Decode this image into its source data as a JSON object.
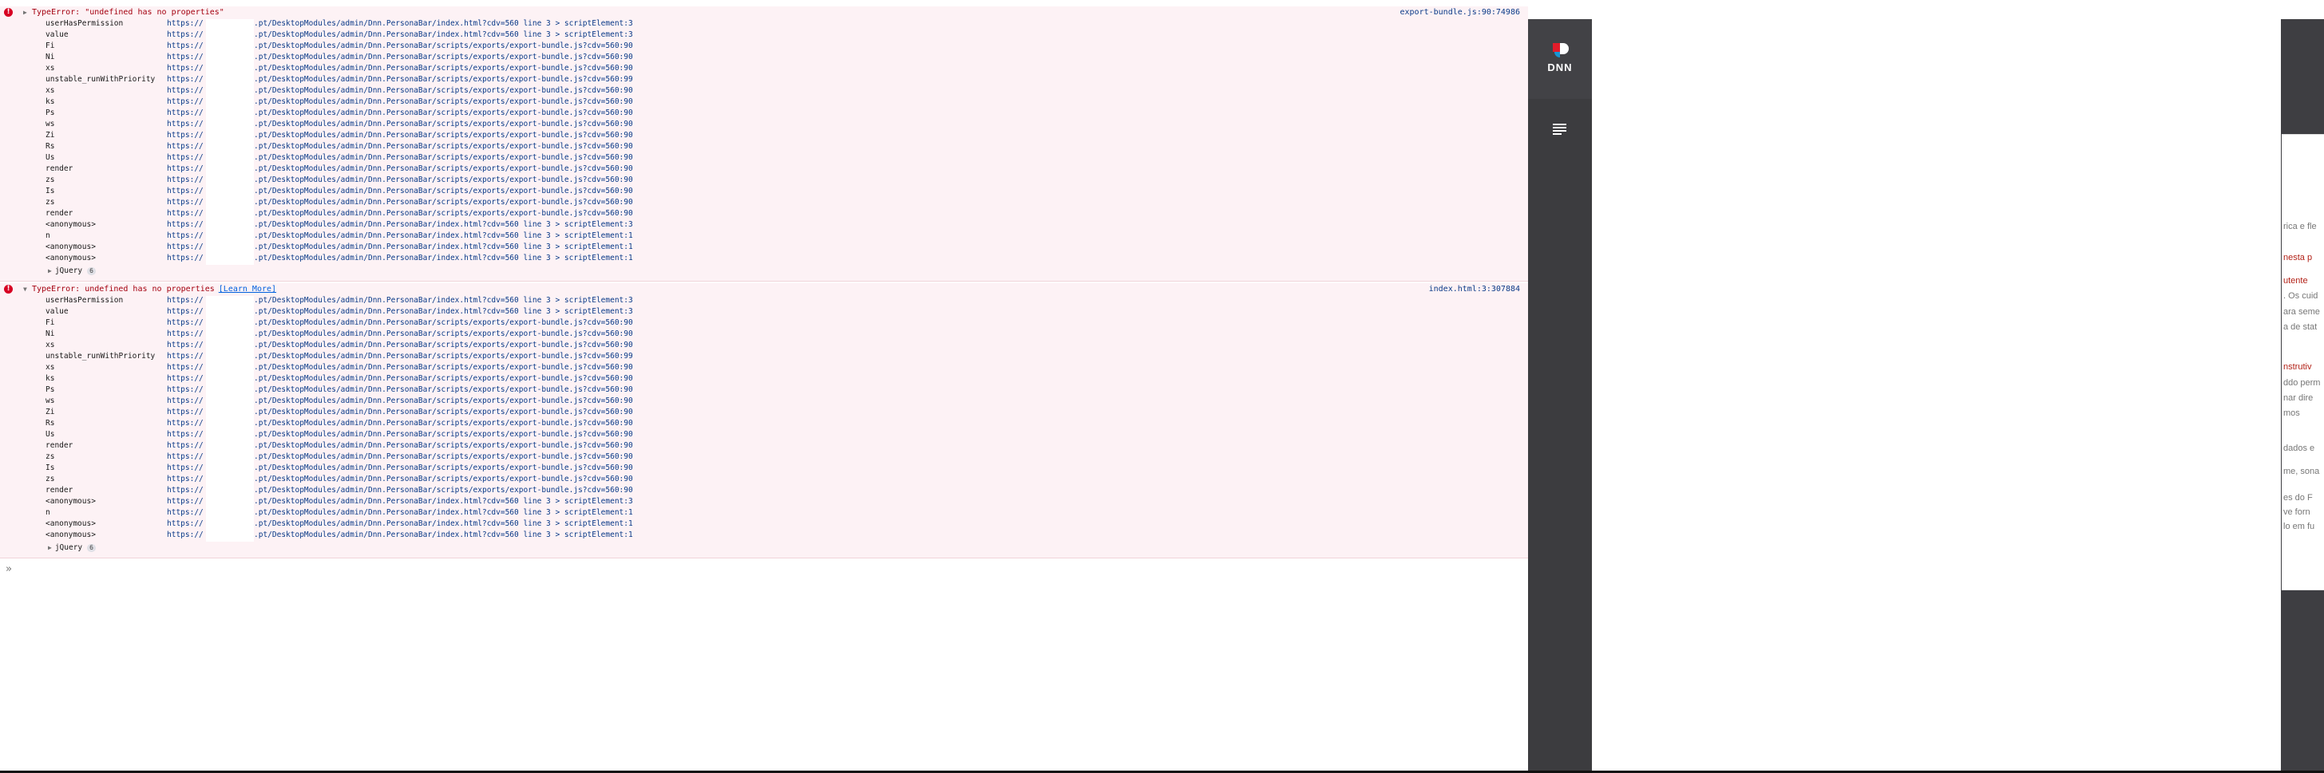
{
  "console": {
    "errors": [
      {
        "message": "TypeError: \"undefined has no properties\"",
        "learn_more": "",
        "source": "export-bundle.js:90:74986",
        "jquery_label": "jQuery",
        "jquery_count": "6"
      },
      {
        "message": "TypeError: undefined has no properties",
        "learn_more": "[Learn More]",
        "source": "index.html:3:307884",
        "jquery_label": "jQuery",
        "jquery_count": "6"
      }
    ],
    "frames": [
      {
        "fn": "userHasPermission",
        "url_prefix": "https://",
        "url_suffix": ".pt/DesktopModules/admin/Dnn.PersonaBar/index.html?cdv=560 line 3 > scriptElement:3"
      },
      {
        "fn": "value",
        "url_prefix": "https://",
        "url_suffix": ".pt/DesktopModules/admin/Dnn.PersonaBar/index.html?cdv=560 line 3 > scriptElement:3"
      },
      {
        "fn": "Fi",
        "url_prefix": "https://",
        "url_suffix": ".pt/DesktopModules/admin/Dnn.PersonaBar/scripts/exports/export-bundle.js?cdv=560:90"
      },
      {
        "fn": "Ni",
        "url_prefix": "https://",
        "url_suffix": ".pt/DesktopModules/admin/Dnn.PersonaBar/scripts/exports/export-bundle.js?cdv=560:90"
      },
      {
        "fn": "xs",
        "url_prefix": "https://",
        "url_suffix": ".pt/DesktopModules/admin/Dnn.PersonaBar/scripts/exports/export-bundle.js?cdv=560:90"
      },
      {
        "fn": "unstable_runWithPriority",
        "url_prefix": "https://",
        "url_suffix": ".pt/DesktopModules/admin/Dnn.PersonaBar/scripts/exports/export-bundle.js?cdv=560:99"
      },
      {
        "fn": "xs",
        "url_prefix": "https://",
        "url_suffix": ".pt/DesktopModules/admin/Dnn.PersonaBar/scripts/exports/export-bundle.js?cdv=560:90"
      },
      {
        "fn": "ks",
        "url_prefix": "https://",
        "url_suffix": ".pt/DesktopModules/admin/Dnn.PersonaBar/scripts/exports/export-bundle.js?cdv=560:90"
      },
      {
        "fn": "Ps",
        "url_prefix": "https://",
        "url_suffix": ".pt/DesktopModules/admin/Dnn.PersonaBar/scripts/exports/export-bundle.js?cdv=560:90"
      },
      {
        "fn": "ws",
        "url_prefix": "https://",
        "url_suffix": ".pt/DesktopModules/admin/Dnn.PersonaBar/scripts/exports/export-bundle.js?cdv=560:90"
      },
      {
        "fn": "Zi",
        "url_prefix": "https://",
        "url_suffix": ".pt/DesktopModules/admin/Dnn.PersonaBar/scripts/exports/export-bundle.js?cdv=560:90"
      },
      {
        "fn": "Rs",
        "url_prefix": "https://",
        "url_suffix": ".pt/DesktopModules/admin/Dnn.PersonaBar/scripts/exports/export-bundle.js?cdv=560:90"
      },
      {
        "fn": "Us",
        "url_prefix": "https://",
        "url_suffix": ".pt/DesktopModules/admin/Dnn.PersonaBar/scripts/exports/export-bundle.js?cdv=560:90"
      },
      {
        "fn": "render",
        "url_prefix": "https://",
        "url_suffix": ".pt/DesktopModules/admin/Dnn.PersonaBar/scripts/exports/export-bundle.js?cdv=560:90"
      },
      {
        "fn": "zs",
        "url_prefix": "https://",
        "url_suffix": ".pt/DesktopModules/admin/Dnn.PersonaBar/scripts/exports/export-bundle.js?cdv=560:90"
      },
      {
        "fn": "Is",
        "url_prefix": "https://",
        "url_suffix": ".pt/DesktopModules/admin/Dnn.PersonaBar/scripts/exports/export-bundle.js?cdv=560:90"
      },
      {
        "fn": "zs",
        "url_prefix": "https://",
        "url_suffix": ".pt/DesktopModules/admin/Dnn.PersonaBar/scripts/exports/export-bundle.js?cdv=560:90"
      },
      {
        "fn": "render",
        "url_prefix": "https://",
        "url_suffix": ".pt/DesktopModules/admin/Dnn.PersonaBar/scripts/exports/export-bundle.js?cdv=560:90"
      },
      {
        "fn": "<anonymous>",
        "url_prefix": "https://",
        "url_suffix": ".pt/DesktopModules/admin/Dnn.PersonaBar/index.html?cdv=560 line 3 > scriptElement:3"
      },
      {
        "fn": "n",
        "url_prefix": "https://",
        "url_suffix": ".pt/DesktopModules/admin/Dnn.PersonaBar/index.html?cdv=560 line 3 > scriptElement:1"
      },
      {
        "fn": "<anonymous>",
        "url_prefix": "https://",
        "url_suffix": ".pt/DesktopModules/admin/Dnn.PersonaBar/index.html?cdv=560 line 3 > scriptElement:1"
      },
      {
        "fn": "<anonymous>",
        "url_prefix": "https://",
        "url_suffix": ".pt/DesktopModules/admin/Dnn.PersonaBar/index.html?cdv=560 line 3 > scriptElement:1"
      }
    ],
    "prompt_symbol": "»"
  },
  "persona_bar": {
    "logo_text": "DNN",
    "logo_colors": {
      "red": "#e21c2a",
      "blue": "#1796d3",
      "white": "#ffffff"
    },
    "page_icon": "document-list-icon"
  },
  "side_panel": {
    "lines": [
      {
        "text": "rica e fle",
        "red": false
      },
      {
        "text": "nesta p",
        "red": true
      },
      {
        "text": "utente",
        "red": true
      },
      {
        "text": ". Os cuid",
        "red": false
      },
      {
        "text": "ara seme",
        "red": false
      },
      {
        "text": "a de stat",
        "red": false
      },
      {
        "text": "nstrutiv",
        "red": true
      },
      {
        "text": "ddo perm",
        "red": false
      },
      {
        "text": "nar dire",
        "red": false
      },
      {
        "text": "mos",
        "red": false
      },
      {
        "text": "dados e",
        "red": false
      },
      {
        "text": "me, sona",
        "red": false
      },
      {
        "text": "es do F",
        "red": false
      },
      {
        "text": "ve forn",
        "red": false
      },
      {
        "text": "lo em fu",
        "red": false
      }
    ]
  },
  "colors": {
    "error_bg": "#fdf2f5",
    "error_text": "#a4000f",
    "link": "#0a3a88",
    "persona_bar": "#3c3c3f"
  }
}
